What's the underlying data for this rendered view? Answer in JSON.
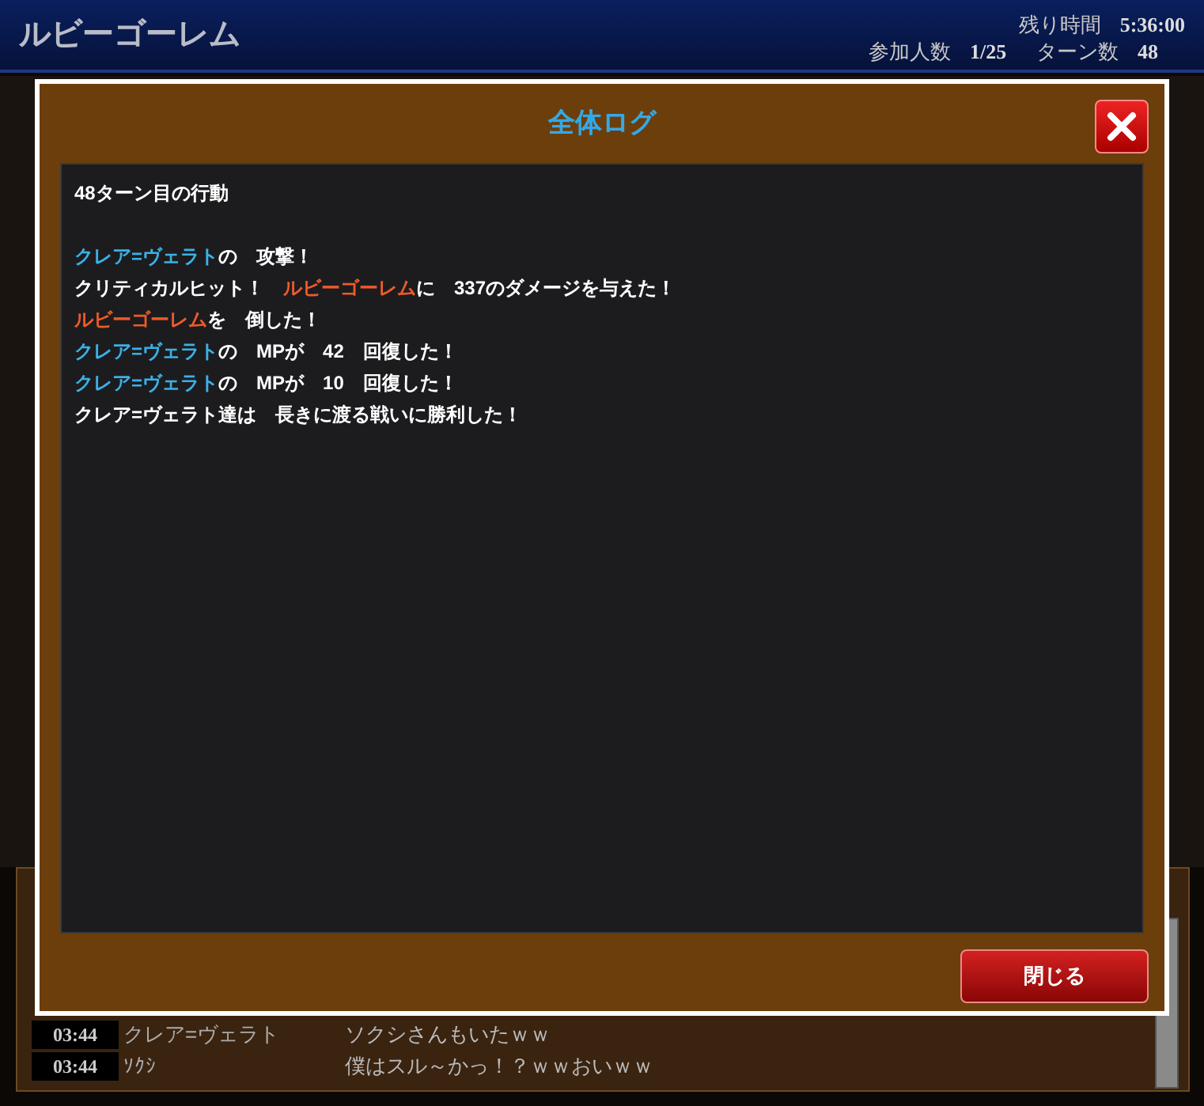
{
  "header": {
    "title": "ルビーゴーレム",
    "stats": [
      {
        "label": "残り時間",
        "value": "5:36:00"
      },
      {
        "label": "参加人数",
        "value": "1/25"
      },
      {
        "label": "ターン数",
        "value": "48"
      }
    ]
  },
  "dialog": {
    "title": "全体ログ",
    "heading": "48ターン目の行動",
    "lines": [
      [
        {
          "kind": "player",
          "text": "クレア=ヴェラト"
        },
        {
          "kind": "text",
          "text": "の　攻撃！"
        }
      ],
      [
        {
          "kind": "text",
          "text": "クリティカルヒット！　"
        },
        {
          "kind": "enemy",
          "text": "ルビーゴーレム"
        },
        {
          "kind": "text",
          "text": "に　337のダメージを与えた！"
        }
      ],
      [
        {
          "kind": "enemy",
          "text": "ルビーゴーレム"
        },
        {
          "kind": "text",
          "text": "を　倒した！"
        }
      ],
      [
        {
          "kind": "player",
          "text": "クレア=ヴェラト"
        },
        {
          "kind": "text",
          "text": "の　MPが　42　回復した！"
        }
      ],
      [
        {
          "kind": "player",
          "text": "クレア=ヴェラト"
        },
        {
          "kind": "text",
          "text": "の　MPが　10　回復した！"
        }
      ],
      [
        {
          "kind": "text",
          "text": "クレア=ヴェラト達は　長きに渡る戦いに勝利した！"
        }
      ]
    ],
    "close_button": "閉じる"
  },
  "chat": [
    {
      "time": "03:44",
      "name": "クレア=ヴェラト",
      "message": "ソクシさんもいたｗｗ"
    },
    {
      "time": "03:44",
      "name": "ｿｸｼ",
      "message": "僕はスル～かっ！？ｗｗおいｗｗ"
    }
  ]
}
